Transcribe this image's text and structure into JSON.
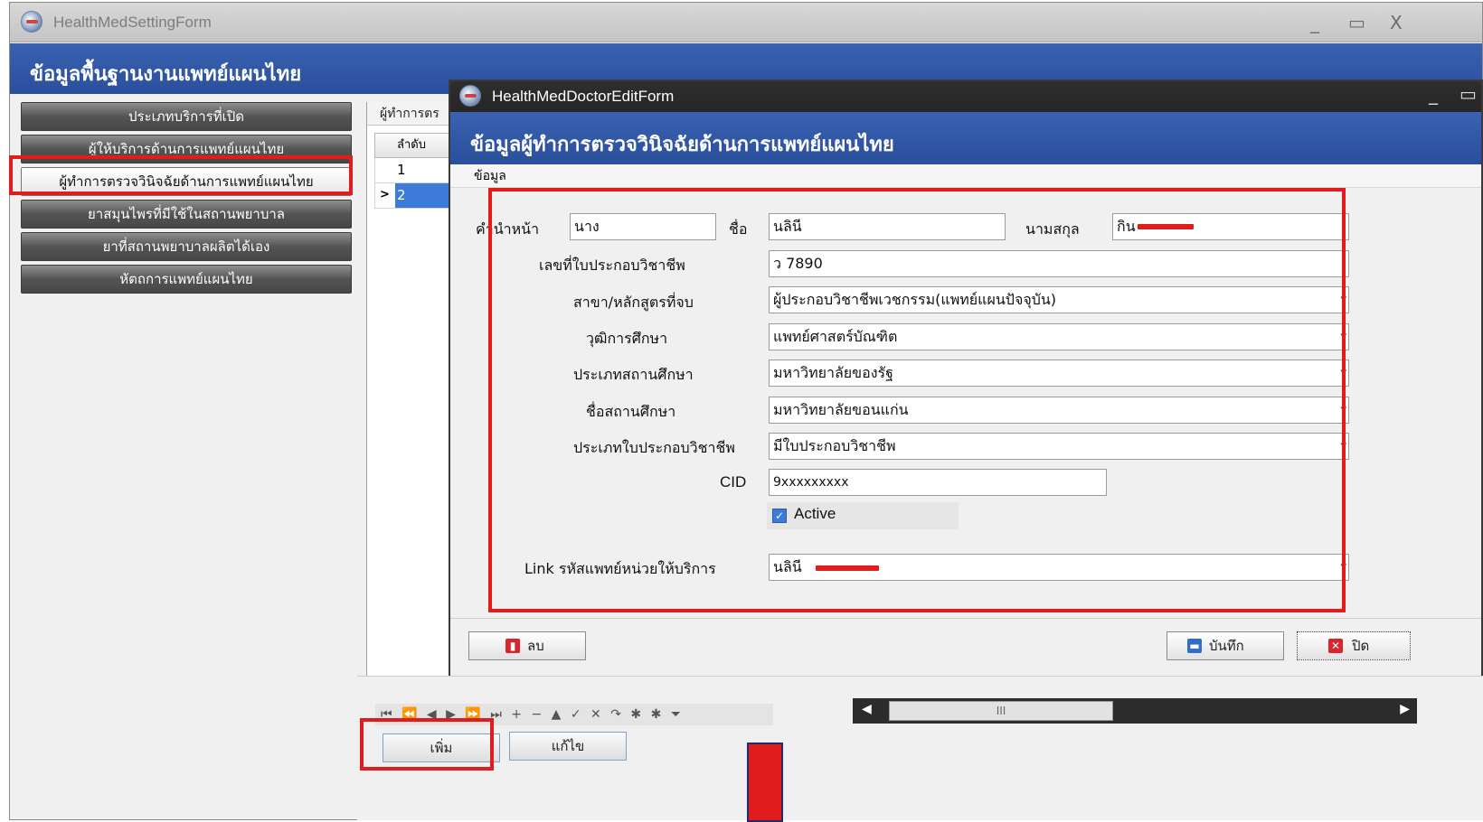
{
  "main_window": {
    "title": "HealthMedSettingForm",
    "header": "ข้อมูลพื้นฐานงานแพทย์แผนไทย",
    "controls": {
      "minimize": "_",
      "maximize": "▭",
      "close": "X"
    },
    "nav_items": [
      {
        "label": "ประเภทบริการที่เปิด"
      },
      {
        "label": "ผู้ให้บริการด้านการแพทย์แผนไทย"
      },
      {
        "label": "ผู้ทำการตรวจวินิจฉัยด้านการแพทย์แผนไทย"
      },
      {
        "label": "ยาสมุนไพรที่มีใช้ในสถานพยาบาล"
      },
      {
        "label": "ยาที่สถานพยาบาลผลิตได้เอง"
      },
      {
        "label": "หัตถการแพทย์แผนไทย"
      }
    ],
    "list_tab_label": "ผู้ทำการตร",
    "grid": {
      "column_header": "ลำดับ",
      "rows": [
        "1",
        "2"
      ],
      "selected_indicator": ">"
    },
    "navigator_symbols": "⏮ ⏪ ◀ ▶ ⏩ ⏭ + − ▲ ✓ ✕ ↷ ✱ ✱ ⏷",
    "scroll_thumb": "III",
    "add_button": "เพิ่ม",
    "edit_button": "แก้ไข"
  },
  "dialog": {
    "title": "HealthMedDoctorEditForm",
    "header": "ข้อมูลผู้ทำการตรวจวินิจฉัยด้านการแพทย์แผนไทย",
    "controls": {
      "minimize": "_",
      "maximize": "▭"
    },
    "menu": "ข้อมูล",
    "form": {
      "prefix_label": "คำนำหน้า",
      "prefix_value": "นาง",
      "name_label": "ชื่อ",
      "name_value": "นลินี",
      "surname_label": "นามสกุล",
      "surname_value": "กิน",
      "license_no_label": "เลขที่ใบประกอบวิชาชีพ",
      "license_no_value": "ว 7890",
      "major_label": "สาขา/หลักสูตรที่จบ",
      "major_value": "ผู้ประกอบวิชาชีพเวชกรรม(แพทย์แผนปัจจุบัน)",
      "degree_label": "วุฒิการศึกษา",
      "degree_value": "แพทย์ศาสตร์บัณฑิต",
      "institution_type_label": "ประเภทสถานศึกษา",
      "institution_type_value": "มหาวิทยาลัยของรัฐ",
      "institution_name_label": "ชื่อสถานศึกษา",
      "institution_name_value": "มหาวิทยาลัยขอนแก่น",
      "license_type_label": "ประเภทใบประกอบวิชาชีพ",
      "license_type_value": "มีใบประกอบวิชาชีพ",
      "cid_label": "CID",
      "cid_value": "9xxxxxxxxx",
      "active_label": "Active",
      "active_checked": true,
      "link_label": "Link รหัสแพทย์หน่วยให้บริการ",
      "link_value": "นลินี"
    },
    "delete_button": "ลบ",
    "save_button": "บันทึก",
    "close_button": "ปิด"
  },
  "colors": {
    "header_blue": "#2f56a4",
    "annotation_red": "#e01c1c",
    "selection_blue": "#3d7bd8"
  }
}
